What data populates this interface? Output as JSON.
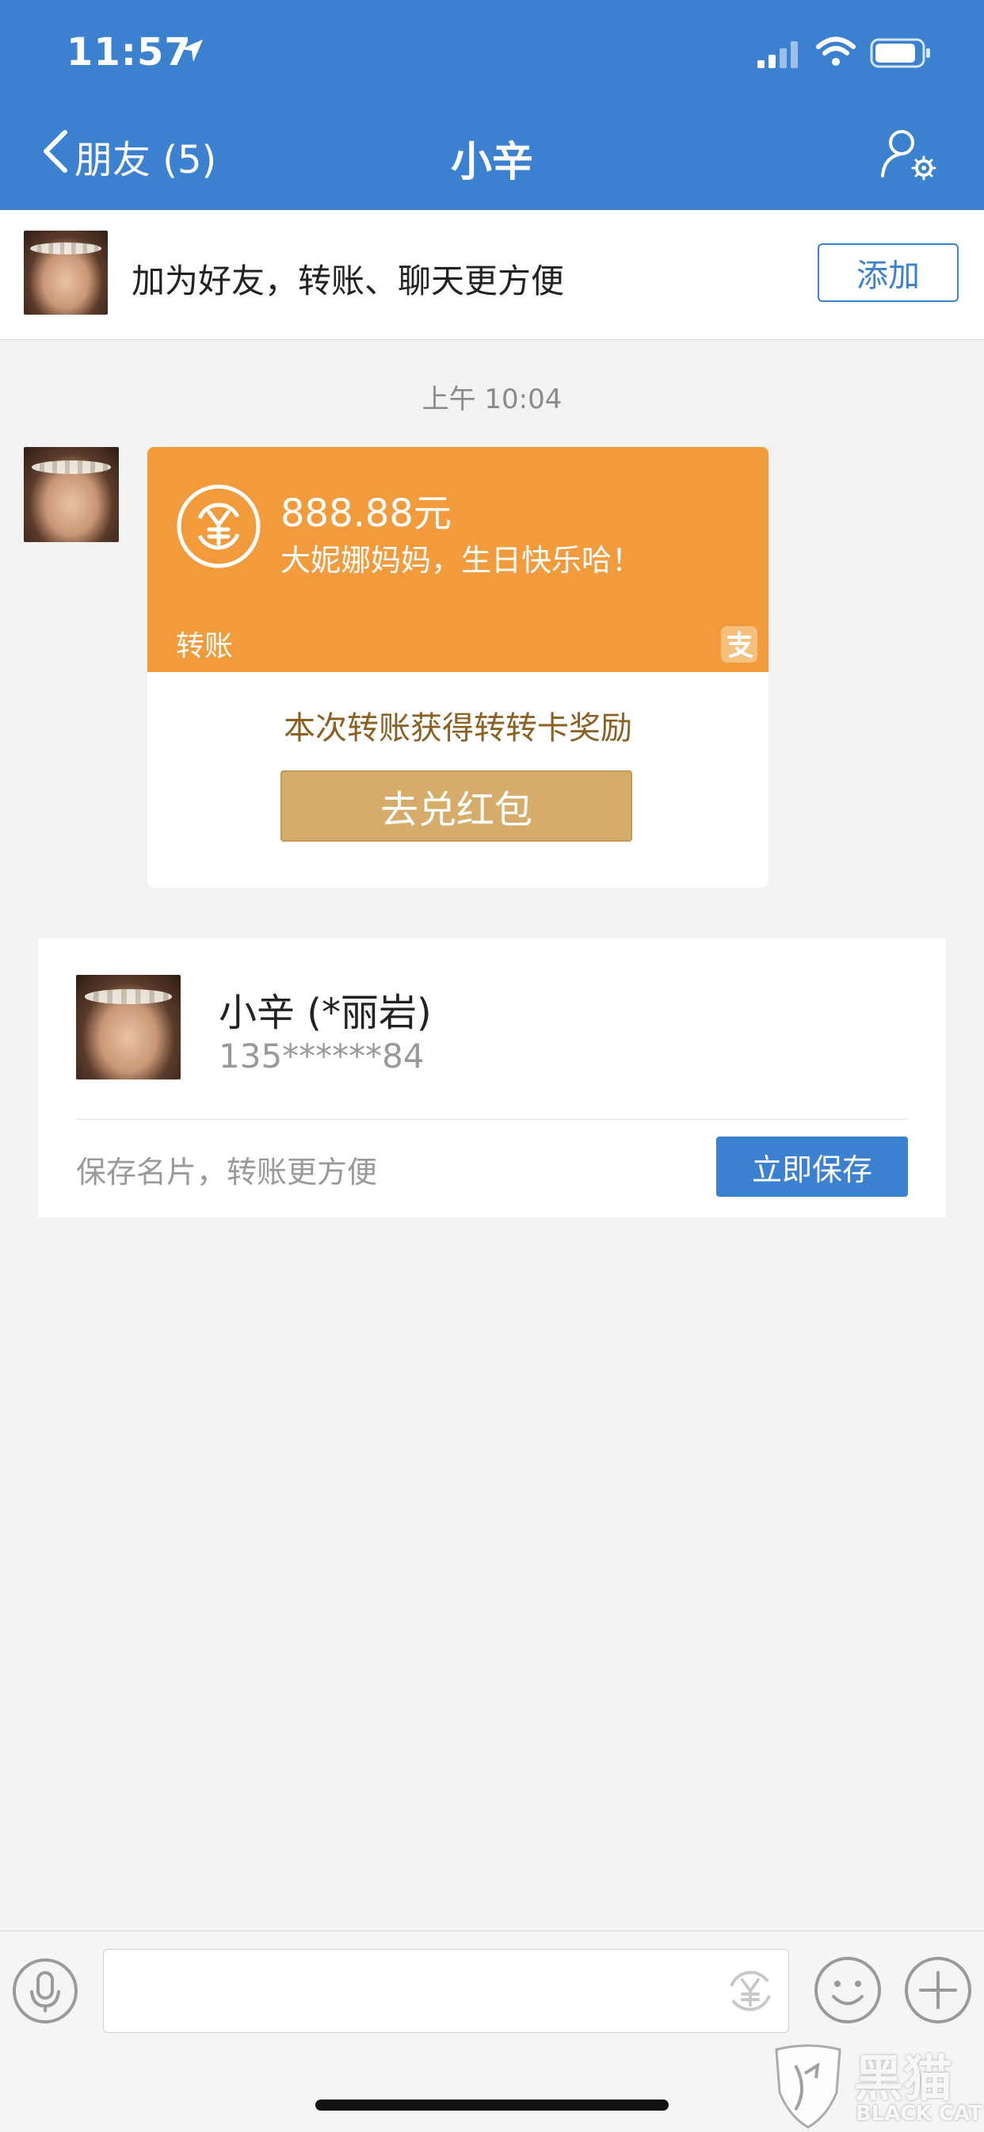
{
  "status": {
    "time": "11:57"
  },
  "nav": {
    "back_label": "朋友 (5)",
    "title": "小辛"
  },
  "banner": {
    "text": "加为好友，转账、聊天更方便",
    "add_label": "添加"
  },
  "chat": {
    "timestamp": "上午 10:04"
  },
  "transfer": {
    "amount": "888.88元",
    "message": "大妮娜妈妈，生日快乐哈！",
    "type_label": "转账",
    "reward_text": "本次转账获得转转卡奖励",
    "redeem_label": "去兑红包"
  },
  "contact": {
    "name": "小辛 (*丽岩)",
    "phone": "135******84",
    "hint": "保存名片，转账更方便",
    "save_label": "立即保存"
  },
  "watermark": {
    "zh": "黑猫",
    "en": "BLACK CAT"
  },
  "colors": {
    "brand_blue": "#3b81d0",
    "transfer_orange": "#f19b3d",
    "redeem_gold": "#d6ac6b"
  }
}
